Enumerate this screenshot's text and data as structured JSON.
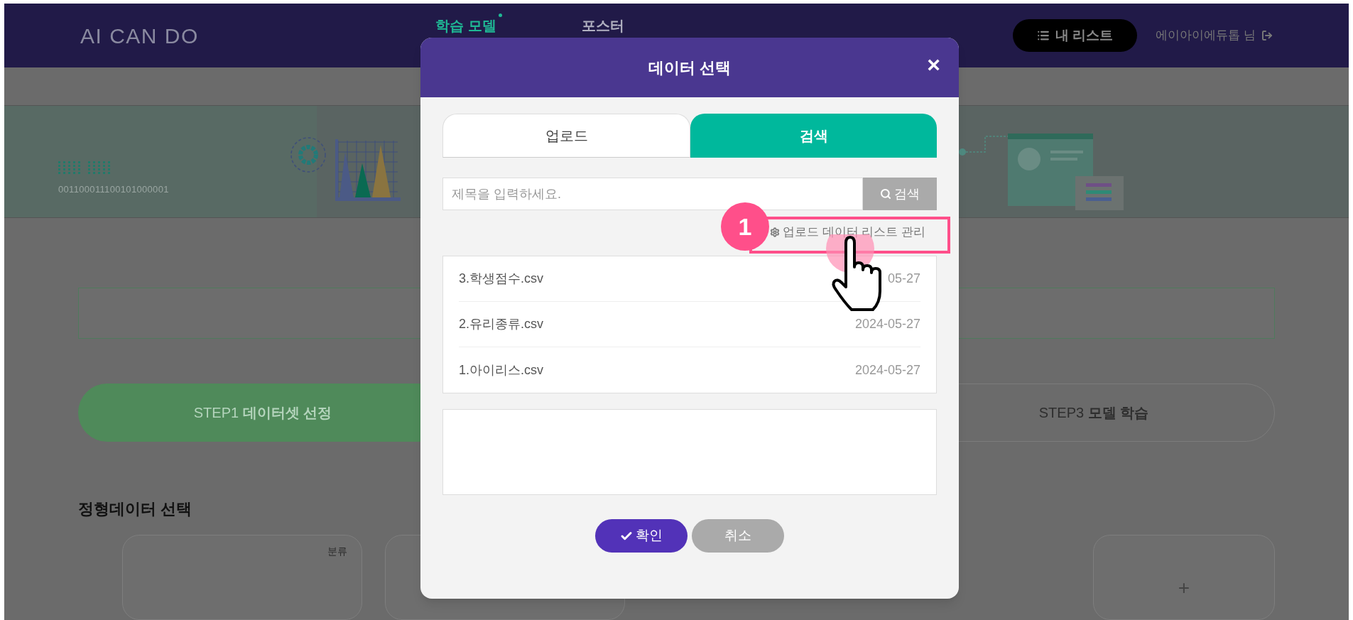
{
  "header": {
    "logo": "AI CAN DO",
    "nav": [
      {
        "label": "학습 모델",
        "selected": true
      },
      {
        "label": "포스터",
        "selected": false
      }
    ],
    "my_list": "내 리스트",
    "user": "에이아이에듀톱 님"
  },
  "banner": {
    "code": "001100011100101000001"
  },
  "steps": [
    {
      "label": "STEP1 **데이터셋 선정**",
      "selected": true
    },
    {
      "label": "STEP3 **모델 학습**",
      "selected": false
    }
  ],
  "section_title": "정형데이터 선택",
  "cards": [
    {
      "kind": "dataset",
      "tag": "분류"
    },
    {
      "kind": "dataset"
    },
    {
      "kind": "add",
      "text": "+"
    }
  ],
  "dialog": {
    "title": "데이터 선택",
    "close": "×",
    "tabs": [
      {
        "label": "업로드",
        "selected": false
      },
      {
        "label": "검색",
        "selected": true
      }
    ],
    "search": {
      "placeholder": "제목을 입력하세요.",
      "button": "검색"
    },
    "manage_link": "업로드 데이터 리스트 관리",
    "files": [
      {
        "name": "3.학생점수.csv",
        "date": "05-27"
      },
      {
        "name": "2.유리종류.csv",
        "date": "2024-05-27"
      },
      {
        "name": "1.아이리스.csv",
        "date": "2024-05-27"
      }
    ],
    "buttons": [
      {
        "kind": "primary",
        "label": "확인"
      },
      {
        "kind": "secondary",
        "label": "취소"
      }
    ]
  },
  "annotation": {
    "number": "1"
  }
}
